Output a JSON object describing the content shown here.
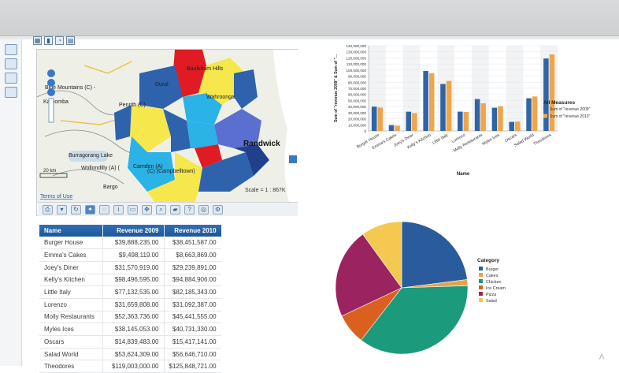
{
  "toolbar_icons": [
    "map-layer-icon",
    "bar-chart-icon",
    "pie-chart-icon",
    "grid-icon"
  ],
  "rail_icons": [
    "report-icon",
    "tree-icon",
    "table-icon",
    "filter-icon"
  ],
  "map": {
    "labels": [
      "Blue Mountains (C) -",
      "Katoomba",
      "Penrith (C)",
      "Baulkham Hills",
      "Wahroonga",
      "Randwick",
      "Camden (A)",
      "Wollondilly (A) (",
      "(C) (Campbelltown)",
      "Dural",
      "Bargo",
      "Burragorang Lake"
    ],
    "scale_text": "Scale = 1 : 867K",
    "scalebar_text": "20 km",
    "terms_text": "Terms of Use",
    "tool_icons": [
      "print-icon",
      "arrow-icon",
      "refresh-icon",
      "select-icon",
      "lasso-icon",
      "info-icon",
      "layer-icon",
      "pan-icon",
      "zoom-icon",
      "measure-icon",
      "help-icon",
      "locate-icon",
      "settings-icon"
    ]
  },
  "table": {
    "headers": [
      "Name",
      "Revenue 2009",
      "Revenue 2010"
    ],
    "rows": [
      [
        "Burger House",
        "$39,888,235.00",
        "$38,451,587.00"
      ],
      [
        "Emma's Cakes",
        "$9,498,119.00",
        "$8,663,869.00"
      ],
      [
        "Joey's Diner",
        "$31,570,919.00",
        "$29,239,891.00"
      ],
      [
        "Kelly's Kitchen",
        "$98,496,595.00",
        "$94,884,906.00"
      ],
      [
        "Little Italy",
        "$77,132,535.00",
        "$82,185,343.00"
      ],
      [
        "Lorenzo",
        "$31,659,808.00",
        "$31,092,387.00"
      ],
      [
        "Molly Restaurants",
        "$52,363,736.00",
        "$45,441,555.00"
      ],
      [
        "Myles Ices",
        "$38,145,053.00",
        "$40,731,330.00"
      ],
      [
        "Oscars",
        "$14,839,483.00",
        "$15,417,141.00"
      ],
      [
        "Salad World",
        "$53,624,309.00",
        "$56,646,710.00"
      ],
      [
        "Theodores",
        "$119,003,000.00",
        "$125,848,721.00"
      ]
    ]
  },
  "chart_data": [
    {
      "type": "bar",
      "ylabel": "Sum of \"revenue 2009\" & Sum of \"...",
      "xlabel": "Name",
      "categories": [
        "Burger House",
        "Emma's Cakes",
        "Joey's Diner",
        "Kelly's Kitchen",
        "Little Italy",
        "Lorenzo",
        "Molly Restaurants",
        "Myles Ices",
        "Oscars",
        "Salad World",
        "Theodores"
      ],
      "series": [
        {
          "name": "Sum of \"revenue 2009\"",
          "values": [
            39888235,
            9498119,
            31570919,
            98496595,
            77132535,
            31659808,
            52363736,
            38145053,
            14839483,
            53624309,
            119003000
          ]
        },
        {
          "name": "Sum of \"revenue 2010\"",
          "values": [
            38451587,
            8663869,
            29239891,
            94884906,
            82185343,
            31092387,
            45441555,
            40731330,
            15417141,
            56646710,
            125848721
          ]
        }
      ],
      "ylim": [
        0,
        140000000
      ],
      "yticks": [
        "0",
        "10,000,000",
        "20,000,000",
        "30,000,000",
        "40,000,000",
        "50,000,000",
        "60,000,000",
        "70,000,000",
        "80,000,000",
        "90,000,000",
        "100,000,000",
        "110,000,000",
        "120,000,000",
        "130,000,000",
        "140,000,000"
      ],
      "legend_title": "All Measures",
      "legend_position": "right",
      "colors": [
        "#2f65a7",
        "#f0a54b"
      ]
    },
    {
      "type": "pie",
      "legend_title": "Category",
      "labels": [
        "Burger",
        "Cakes",
        "Chicken",
        "Ice Cream",
        "Pizza",
        "Salad"
      ],
      "values": [
        23,
        1.5,
        36,
        7.5,
        22,
        10
      ],
      "colors": [
        "#2a5b9c",
        "#e6a34a",
        "#1b9a7c",
        "#d9601f",
        "#9b2460",
        "#f5c94f"
      ],
      "legend_position": "right"
    }
  ]
}
